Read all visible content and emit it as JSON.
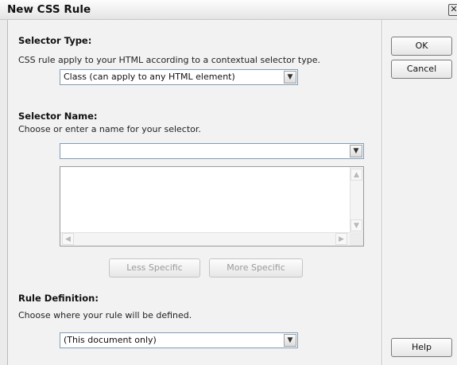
{
  "dialog": {
    "title": "New CSS Rule",
    "close_glyph": "✕"
  },
  "selector_type": {
    "heading": "Selector Type:",
    "description": "CSS rule apply to your HTML according to a contextual selector type.",
    "selected": "Class (can apply to any HTML element)"
  },
  "selector_name": {
    "heading": "Selector Name:",
    "description": "Choose or enter a name for your selector.",
    "value": "",
    "less_specific_label": "Less Specific",
    "more_specific_label": "More Specific"
  },
  "rule_definition": {
    "heading": "Rule Definition:",
    "description": "Choose where your rule will be defined.",
    "selected": "(This document only)"
  },
  "buttons": {
    "ok_label": "OK",
    "cancel_label": "Cancel",
    "help_label": "Help"
  },
  "icons": {
    "dropdown": "chevron-down-icon",
    "scroll_up": "arrow-up-icon",
    "scroll_down": "arrow-down-icon",
    "scroll_left": "arrow-left-icon",
    "scroll_right": "arrow-right-icon"
  }
}
